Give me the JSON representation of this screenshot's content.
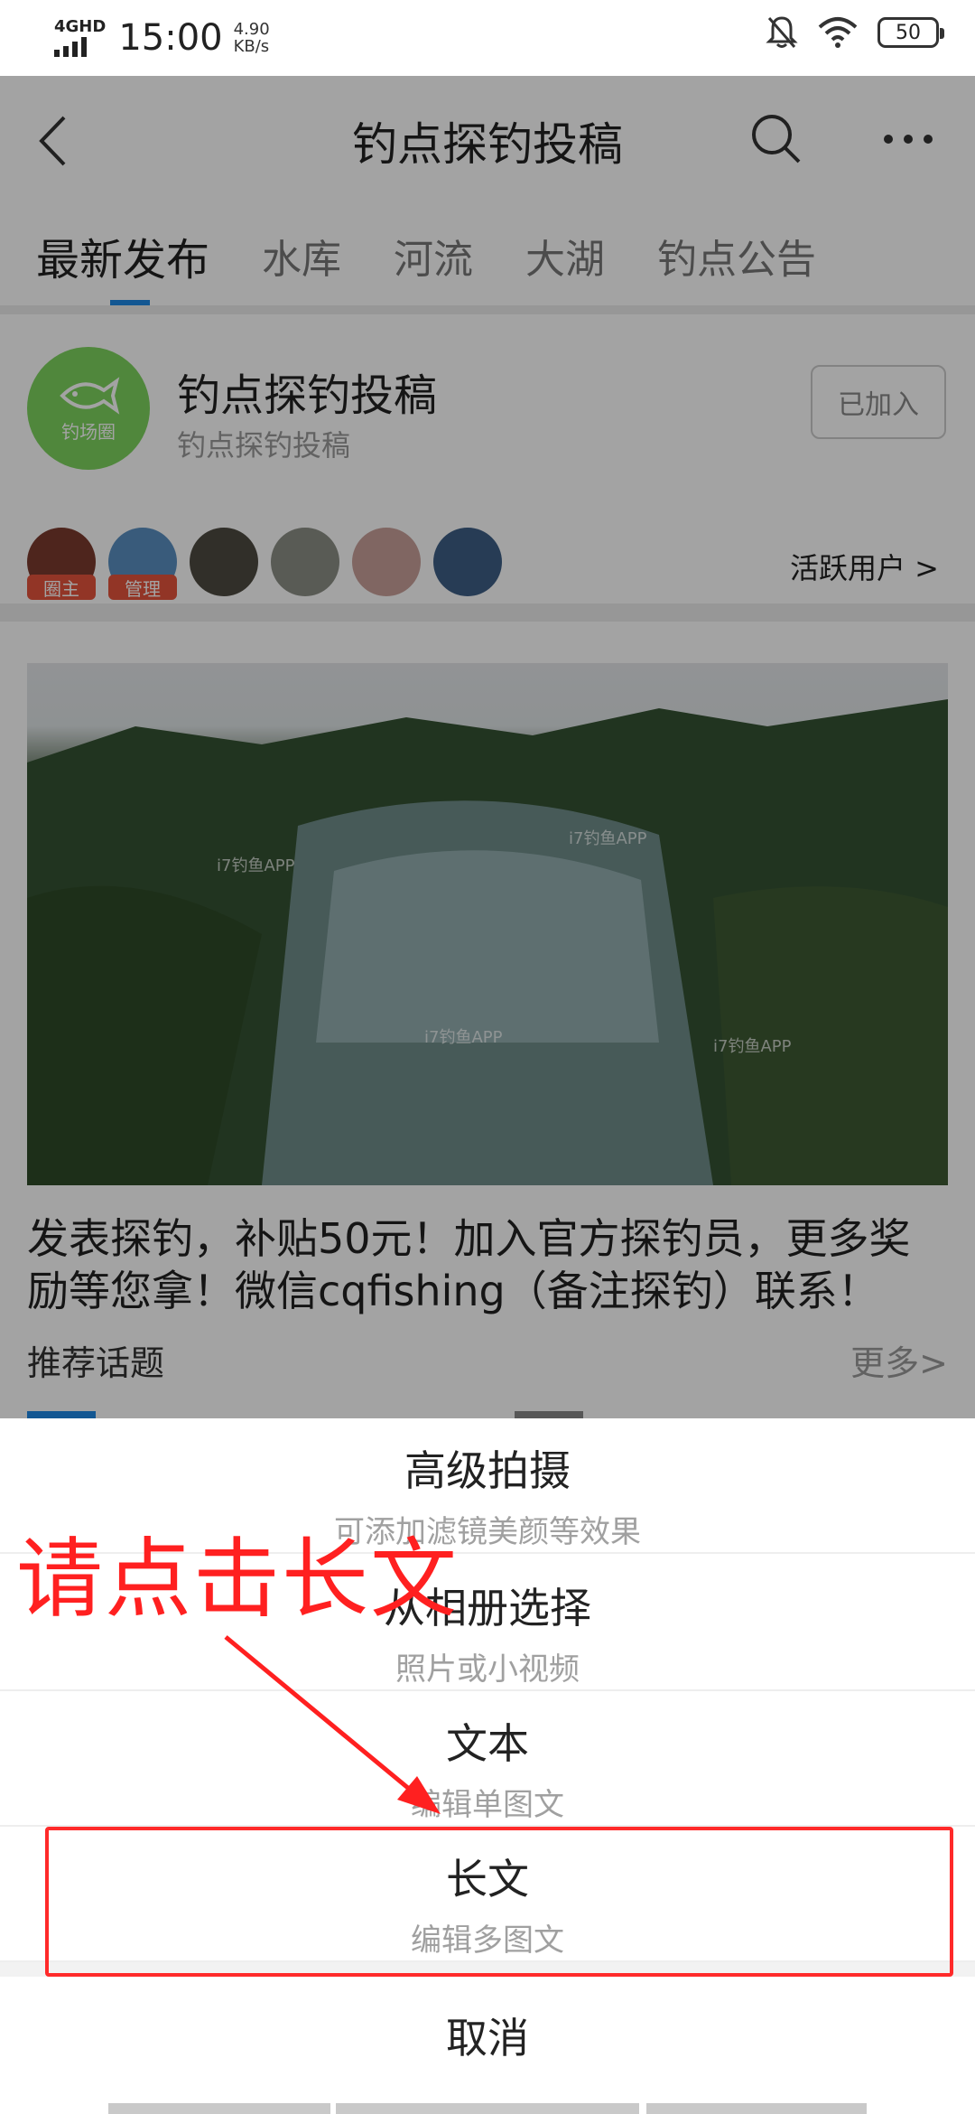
{
  "status_bar": {
    "network": "4GHD",
    "time": "15:00",
    "speed_value": "4.90",
    "speed_unit": "KB/s",
    "battery": "50"
  },
  "header": {
    "title": "钓点探钓投稿"
  },
  "tabs": [
    {
      "label": "最新发布",
      "active": true
    },
    {
      "label": "水库",
      "active": false
    },
    {
      "label": "河流",
      "active": false
    },
    {
      "label": "大湖",
      "active": false
    },
    {
      "label": "钓点公告",
      "active": false
    }
  ],
  "group": {
    "logo_text": "钓场圈",
    "name": "钓点探钓投稿",
    "subtitle": "钓点探钓投稿",
    "join_label": "已加入",
    "avatar_tags": [
      "圈主",
      "管理"
    ],
    "active_users_label": "活跃用户 >"
  },
  "post": {
    "text": "发表探钓，补贴50元！加入官方探钓员，更多奖励等您拿！微信cqfishing（备注探钓）联系！",
    "watermark": "i7钓鱼APP"
  },
  "topics": {
    "label": "推荐话题",
    "more": "更多>"
  },
  "sheet": {
    "items": [
      {
        "title": "高级拍摄",
        "sub": "可添加滤镜美颜等效果"
      },
      {
        "title": "从相册选择",
        "sub": "照片或小视频"
      },
      {
        "title": "文本",
        "sub": "编辑单图文"
      },
      {
        "title": "长文",
        "sub": "编辑多图文"
      }
    ],
    "cancel": "取消"
  },
  "annotation": {
    "text": "请点击长文",
    "color": "#ff2020"
  },
  "colors": {
    "accent": "#1e88e5",
    "group_logo": "#7dd35f",
    "tag": "#e5533c"
  }
}
